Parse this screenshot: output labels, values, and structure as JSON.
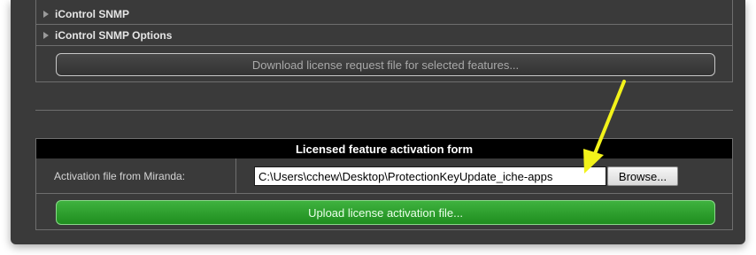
{
  "sections": [
    {
      "label": "iControl SNMP"
    },
    {
      "label": "iControl SNMP Options"
    }
  ],
  "download_button": {
    "label": "Download license request file for selected features..."
  },
  "activation_form": {
    "title": "Licensed feature activation form",
    "file_label": "Activation file from Miranda:",
    "file_value": "C:\\Users\\cchew\\Desktop\\ProtectionKeyUpdate_iche-apps",
    "browse_label": "Browse...",
    "upload_label": "Upload license activation file..."
  },
  "colors": {
    "background": "#3a3a3a",
    "header": "#000000",
    "upload_green": "#2ea32e",
    "annotation_arrow": "#f2f21a"
  },
  "icons": [
    "expand-triangle-icon",
    "annotation-arrow"
  ]
}
